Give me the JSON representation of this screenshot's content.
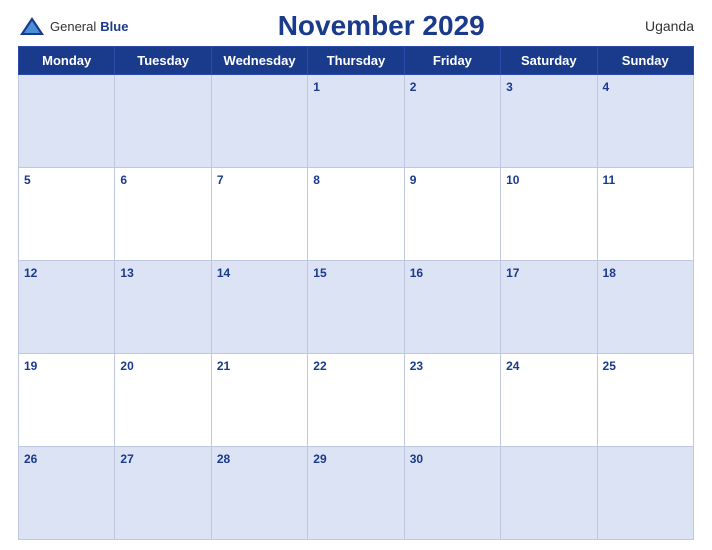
{
  "header": {
    "logo_general": "General",
    "logo_blue": "Blue",
    "title": "November 2029",
    "country": "Uganda"
  },
  "weekdays": [
    "Monday",
    "Tuesday",
    "Wednesday",
    "Thursday",
    "Friday",
    "Saturday",
    "Sunday"
  ],
  "weeks": [
    [
      "",
      "",
      "",
      "1",
      "2",
      "3",
      "4"
    ],
    [
      "5",
      "6",
      "7",
      "8",
      "9",
      "10",
      "11"
    ],
    [
      "12",
      "13",
      "14",
      "15",
      "16",
      "17",
      "18"
    ],
    [
      "19",
      "20",
      "21",
      "22",
      "23",
      "24",
      "25"
    ],
    [
      "26",
      "27",
      "28",
      "29",
      "30",
      "",
      ""
    ]
  ]
}
